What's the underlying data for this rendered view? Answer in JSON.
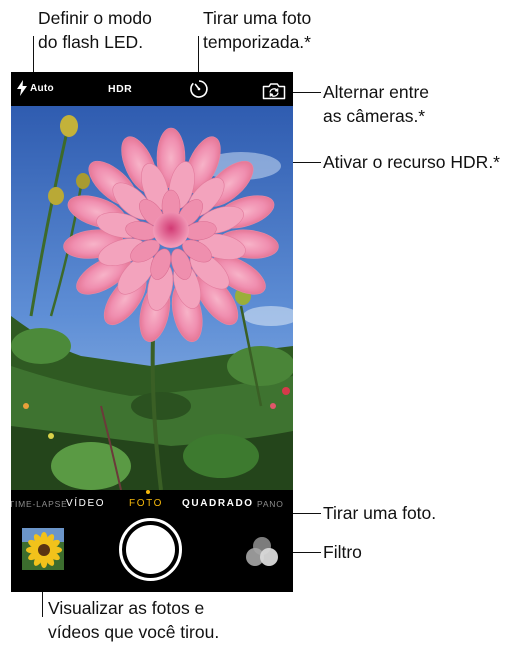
{
  "callouts": {
    "flash": [
      "Definir o modo",
      "do flash LED."
    ],
    "timer": [
      "Tirar uma foto",
      "temporizada.*"
    ],
    "switch_camera": [
      "Alternar entre",
      "as câmeras.*"
    ],
    "hdr": [
      "Ativar o recurso HDR.*"
    ],
    "take_photo": [
      "Tirar uma foto."
    ],
    "filter": [
      "Filtro"
    ],
    "view_photos": [
      "Visualizar as fotos e",
      "vídeos que você tirou."
    ]
  },
  "camera": {
    "flash_mode": "Auto",
    "hdr_label": "HDR",
    "modes": {
      "timelapse": "TIME-LAPSE",
      "video": "VÍDEO",
      "photo": "FOTO",
      "square": "QUADRADO",
      "pano": "PANO"
    },
    "selected_mode": "FOTO",
    "icons": {
      "flash": "lightning-bolt-icon",
      "timer": "timer-icon",
      "switch_camera": "camera-flip-icon",
      "filter": "filter-circles-icon"
    },
    "colors": {
      "selected_mode": "#f5b80c",
      "bar": "#000000",
      "controls": "#ffffff"
    }
  }
}
